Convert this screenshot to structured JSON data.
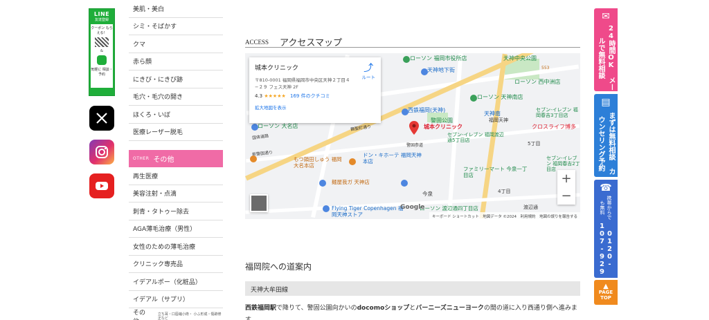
{
  "social": {
    "line": {
      "title": "LINE",
      "sub": "友達登録",
      "coupon": "クーポン もらえる！",
      "amp": "&",
      "consult": "気軽に 相談・予約"
    },
    "x_label": "X",
    "instagram_label": "Instagram",
    "youtube_label": "YouTube"
  },
  "sidebar": {
    "items_top": [
      "美肌・美白",
      "シミ・そばかす",
      "クマ",
      "赤ら顔",
      "にきび・にきび跡",
      "毛穴・毛穴の開き",
      "ほくろ・いぼ",
      "医療レーザー脱毛"
    ],
    "other_tag": "OTHER",
    "other_label": "その他",
    "items_other": [
      "再生医療",
      "美容注射・点滴",
      "刺青・タトゥー除去",
      "AGA薄毛治療（男性）",
      "女性のための薄毛治療",
      "クリニック専売品",
      "イデアルポー（化粧品）",
      "イデアル（サプリ）"
    ],
    "last_item": "その他",
    "last_note": "立ち耳・口唇縮小術・ 小ふ形成・傷跡修正など"
  },
  "access": {
    "en": "ACCESS",
    "jp": "アクセスマップ"
  },
  "map": {
    "card_title": "城本クリニック",
    "card_address": "〒810-0001 福岡県福岡市中央区天神２丁目４−２９ フェス天神 2F",
    "card_rating": "4.3",
    "card_stars": "★★★★★",
    "card_reviews": "169 件のクチコミ",
    "card_large_map": "拡大地図を表示",
    "card_route": "ルート",
    "pin_label": "城本クリニック",
    "labels": {
      "lawson_city": "ローソン 福岡市役所店",
      "tenjin_central_park": "天神中央公園",
      "tenjin_underground": "天神地下街",
      "lawson_nishinakasu": "ローソン 西中洲店",
      "kego_park": "警固公園",
      "lawson_tenjin_minami": "ローソン 天神南店",
      "nishitetsu": "西鉄福岡(天神)",
      "seven_haruyoshi": "セブン-イレブン 福岡春吉3丁目店",
      "tenjin_minami": "天神南",
      "fukuoka_tenjin": "福岡天神",
      "lawson_daimyo": "ローソン 大名店",
      "cross_life": "クロスライフ博多",
      "seven_watanabe": "セブン-イレブン 福岡渡辺通5丁目店",
      "motsunabe": "もつ鍋田しゅう 福岡大名本店",
      "donki": "ドン・キホーテ 福岡天神本店",
      "familymart": "ファミリーマート 今泉一丁目店",
      "menya": "麺屋我ガ 天神店",
      "imaizumi": "今泉",
      "flying_tiger": "Flying Tiger Copenhagen 福岡天神ストア",
      "lawson_watanabe": "ローソン 渡辺通四丁目店",
      "watanabe": "渡辺通",
      "haruyoshi2": "セブン-イレブン 福岡春吉2丁目店",
      "kokutai": "国体道路",
      "kego_dori": "警固本通り",
      "kego_sando": "警固参道",
      "shinryo": "新警固通り",
      "oyafuko": "親不孝通り",
      "tsuru": "鶴聖町通り",
      "yakiin": "薬院通り",
      "chome4": "4丁目",
      "chome5": "5丁目",
      "r553": "553"
    },
    "attribution": "キーボード ショートカット　地図データ ©2024　利用規約　地図の誤りを報告する",
    "google": "Google",
    "zoom_in": "+",
    "zoom_out": "−"
  },
  "guide": {
    "title": "福岡院への道案内",
    "line_name": "天神大牟田線",
    "text_b1": "西鉄福岡駅",
    "text_1": "で降りて、警固公園向かいの",
    "text_b2": "docomoショップ",
    "text_2": "と",
    "text_b3": "バーニーズニューヨーク",
    "text_3": "の間の道に入り西通り側へ進みます。"
  },
  "right_buttons": {
    "mail": "24時間OK メールで無料相談",
    "counseling": "まずは無料相談 カウンセリング予約",
    "tel_note": "携帯からでも無料",
    "tel_number": "0120-107-929",
    "top_line1": "PAGE",
    "top_line2": "TOP"
  },
  "colors": {
    "pink": "#ef4a8a",
    "line_green": "#1fae3a",
    "blue": "#2d7fd8",
    "orange": "#f08a1e"
  }
}
